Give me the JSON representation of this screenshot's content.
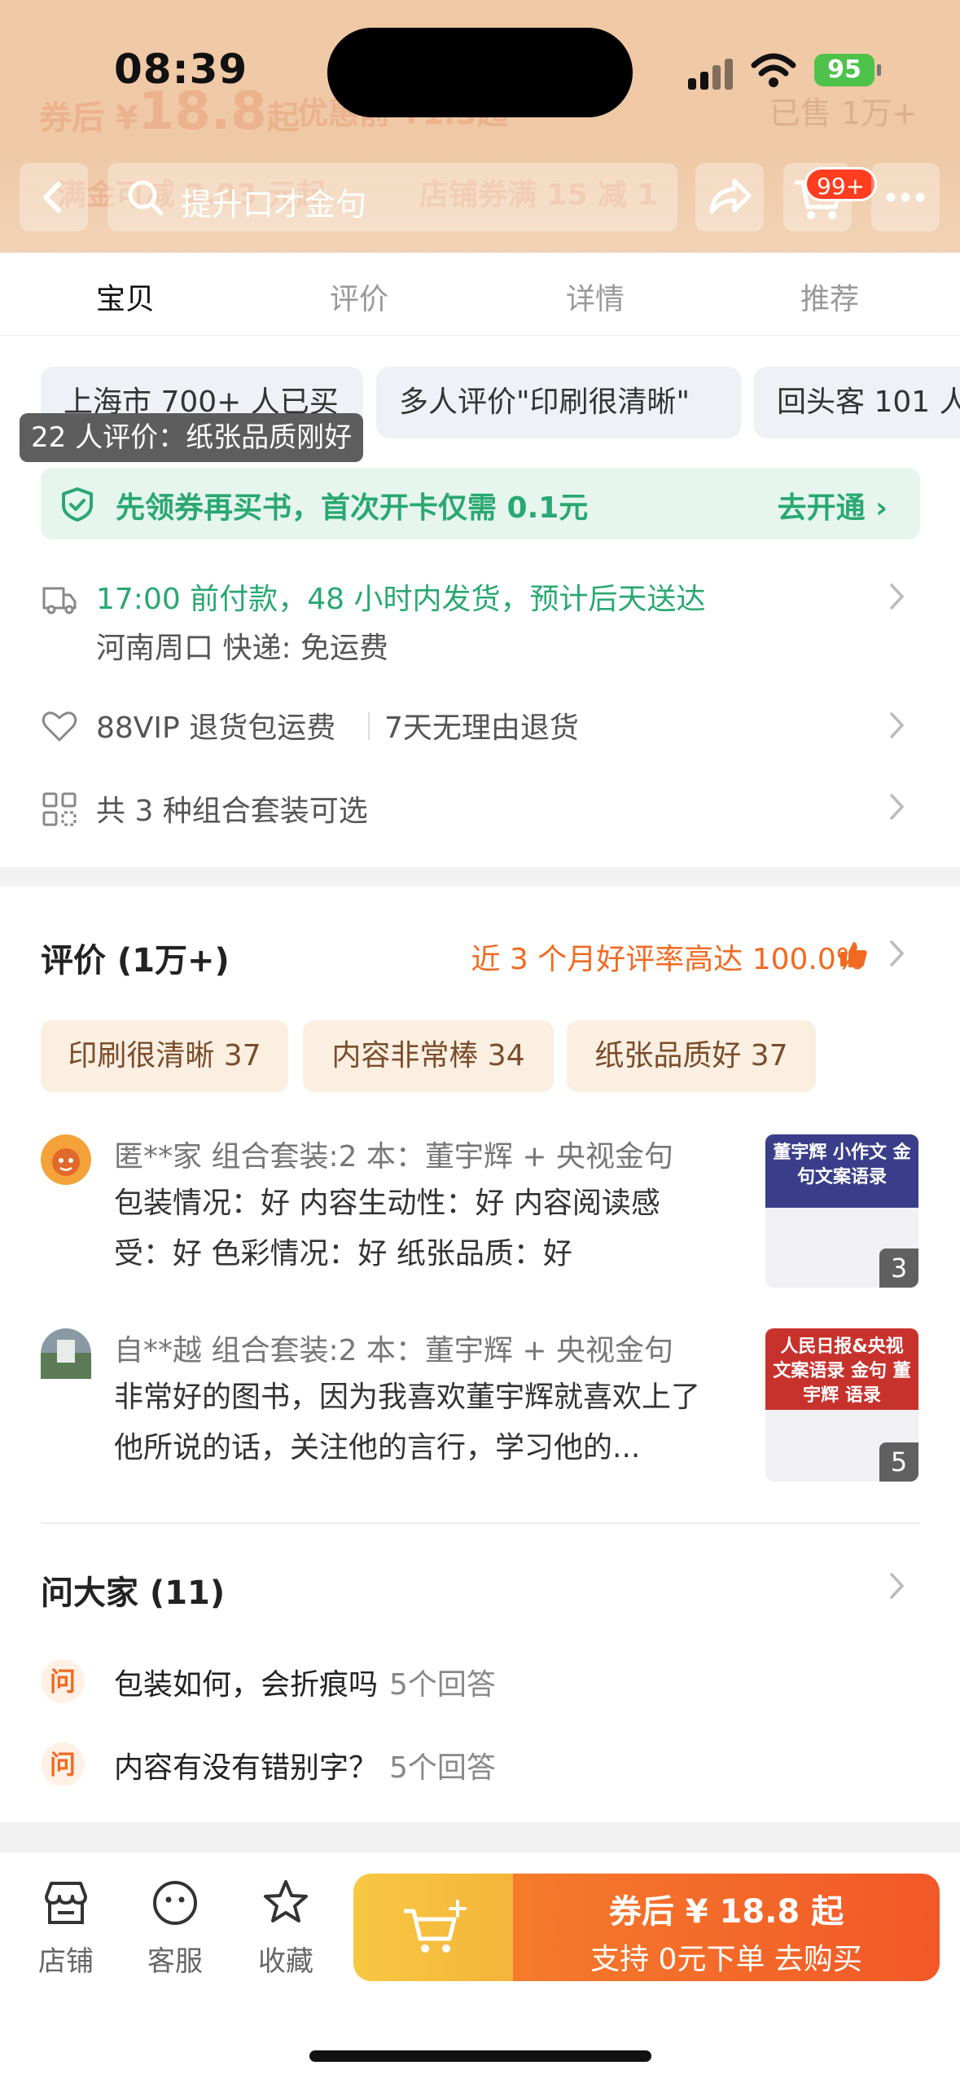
{
  "status_bar": {
    "time": "08:39",
    "battery": "95"
  },
  "header": {
    "bg_price_prefix": "券后 ¥",
    "bg_price": "18.8",
    "bg_price_suffix": "起",
    "bg_promo": "优惠前 ¥1.3起",
    "bg_sold": "已售 1万+",
    "bg_promo2": "满金可减 2.93 元起",
    "bg_promo3": "店铺券满 15 减 1",
    "search_text": "提升口才金句",
    "cart_badge": "99+"
  },
  "tabs": [
    {
      "label": "宝贝"
    },
    {
      "label": "评价"
    },
    {
      "label": "详情"
    },
    {
      "label": "推荐"
    }
  ],
  "chips": [
    {
      "label": "上海市 700+ 人已买"
    },
    {
      "label": "多人评价\"印刷很清晰\""
    },
    {
      "label": "回头客 101 人"
    }
  ],
  "tooltip": "22 人评价：纸张品质刚好",
  "promo_bar": {
    "text": "先领券再买书，首次开卡仅需 0.1元",
    "action": "去开通 ›"
  },
  "delivery": {
    "line1": "17:00 前付款，48 小时内发货，预计后天送达",
    "line2": "河南周口  快递: 免运费"
  },
  "service": {
    "item1": "88VIP 退货包运费",
    "item2": "7天无理由退货"
  },
  "combo": {
    "text": "共 3 种组合套装可选"
  },
  "reviews": {
    "title": "评价 (1万+)",
    "good_rate": "近 3 个月好评率高达 100.0%",
    "tags": [
      {
        "label": "印刷很清晰 37"
      },
      {
        "label": "内容非常棒 34"
      },
      {
        "label": "纸张品质好 37"
      }
    ],
    "items": [
      {
        "name": "匿**家   组合套装:2 本：董宇辉 + 央视金句",
        "body": "包装情况：好 内容生动性：好 内容阅读感受：好 色彩情况：好 纸张品质：好",
        "thumb_text": "董宇辉 小作文 金句文案语录",
        "thumb_count": "3"
      },
      {
        "name": "自**越   组合套装:2 本：董宇辉 + 央视金句",
        "body": "非常好的图书，因为我喜欢董宇辉就喜欢上了他所说的话，关注他的言行，学习他的...",
        "thumb_text": "人民日报&央视 文案语录 金句 董宇辉 语录",
        "thumb_count": "5"
      }
    ]
  },
  "qa": {
    "title": "问大家 (11)",
    "icon_label": "问",
    "items": [
      {
        "question": "包装如何，会折痕吗",
        "answers": "5个回答"
      },
      {
        "question": "内容有没有错别字？",
        "answers": "5个回答"
      }
    ]
  },
  "bottom_bar": {
    "shop": "店铺",
    "service": "客服",
    "favorite": "收藏",
    "buy_main": "券后 ¥ 18.8 起",
    "buy_sub": "支持 0元下单  去购买"
  },
  "colors": {
    "accent_orange": "#f26a22",
    "accent_green": "#2aa872",
    "cart_yellow": "#f7c842",
    "buy_orange": "#f25828"
  }
}
